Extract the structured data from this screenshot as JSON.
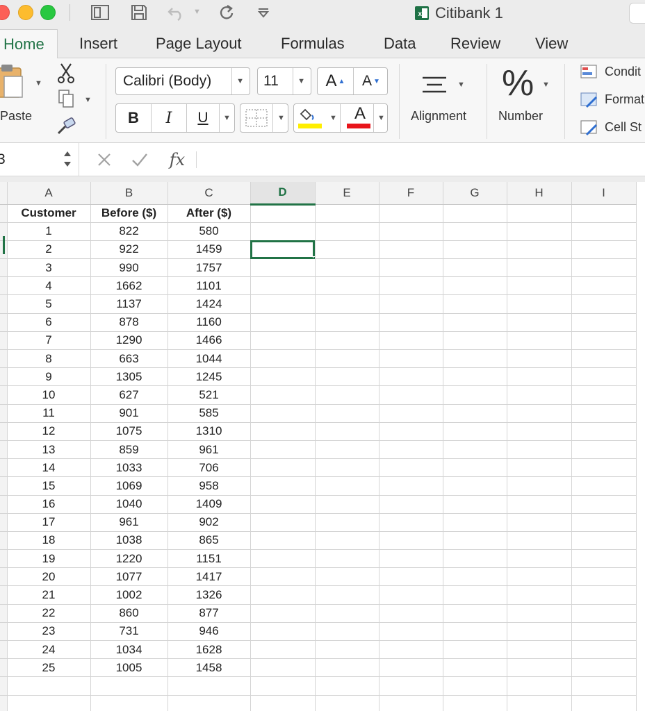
{
  "window": {
    "title": "Citibank 1",
    "icons": [
      "sidebar-icon",
      "save-icon",
      "undo-icon",
      "redo-icon",
      "customize-icon",
      "excel-icon"
    ]
  },
  "tabs": [
    "Home",
    "Insert",
    "Page Layout",
    "Formulas",
    "Data",
    "Review",
    "View"
  ],
  "active_tab": "Home",
  "ribbon": {
    "paste_label": "Paste",
    "font_name": "Calibri (Body)",
    "font_size": "11",
    "grow_font": "A",
    "shrink_font": "A",
    "bold": "B",
    "italic": "I",
    "underline": "U",
    "font_color_glyph": "A",
    "alignment_label": "Alignment",
    "number_glyph": "%",
    "number_label": "Number",
    "styles": [
      "Condit",
      "Format",
      "Cell St"
    ],
    "colors": {
      "highlight": "#ffee00",
      "font_color": "#e8141b",
      "accent": "#217346"
    }
  },
  "formula_bar": {
    "name_box": "3",
    "fx": "fx",
    "content": ""
  },
  "sheet": {
    "columns": [
      "A",
      "B",
      "C",
      "D",
      "E",
      "F",
      "G",
      "H",
      "I"
    ],
    "selected_column": "D",
    "headers": [
      "Customer",
      "Before ($)",
      "After ($)"
    ],
    "rows": [
      [
        "1",
        "822",
        "580"
      ],
      [
        "2",
        "922",
        "1459"
      ],
      [
        "3",
        "990",
        "1757"
      ],
      [
        "4",
        "1662",
        "1101"
      ],
      [
        "5",
        "1137",
        "1424"
      ],
      [
        "6",
        "878",
        "1160"
      ],
      [
        "7",
        "1290",
        "1466"
      ],
      [
        "8",
        "663",
        "1044"
      ],
      [
        "9",
        "1305",
        "1245"
      ],
      [
        "10",
        "627",
        "521"
      ],
      [
        "11",
        "901",
        "585"
      ],
      [
        "12",
        "1075",
        "1310"
      ],
      [
        "13",
        "859",
        "961"
      ],
      [
        "14",
        "1033",
        "706"
      ],
      [
        "15",
        "1069",
        "958"
      ],
      [
        "16",
        "1040",
        "1409"
      ],
      [
        "17",
        "961",
        "902"
      ],
      [
        "18",
        "1038",
        "865"
      ],
      [
        "19",
        "1220",
        "1151"
      ],
      [
        "20",
        "1077",
        "1417"
      ],
      [
        "21",
        "1002",
        "1326"
      ],
      [
        "22",
        "860",
        "877"
      ],
      [
        "23",
        "731",
        "946"
      ],
      [
        "24",
        "1034",
        "1628"
      ],
      [
        "25",
        "1005",
        "1458"
      ]
    ],
    "active_cell": "D3"
  }
}
